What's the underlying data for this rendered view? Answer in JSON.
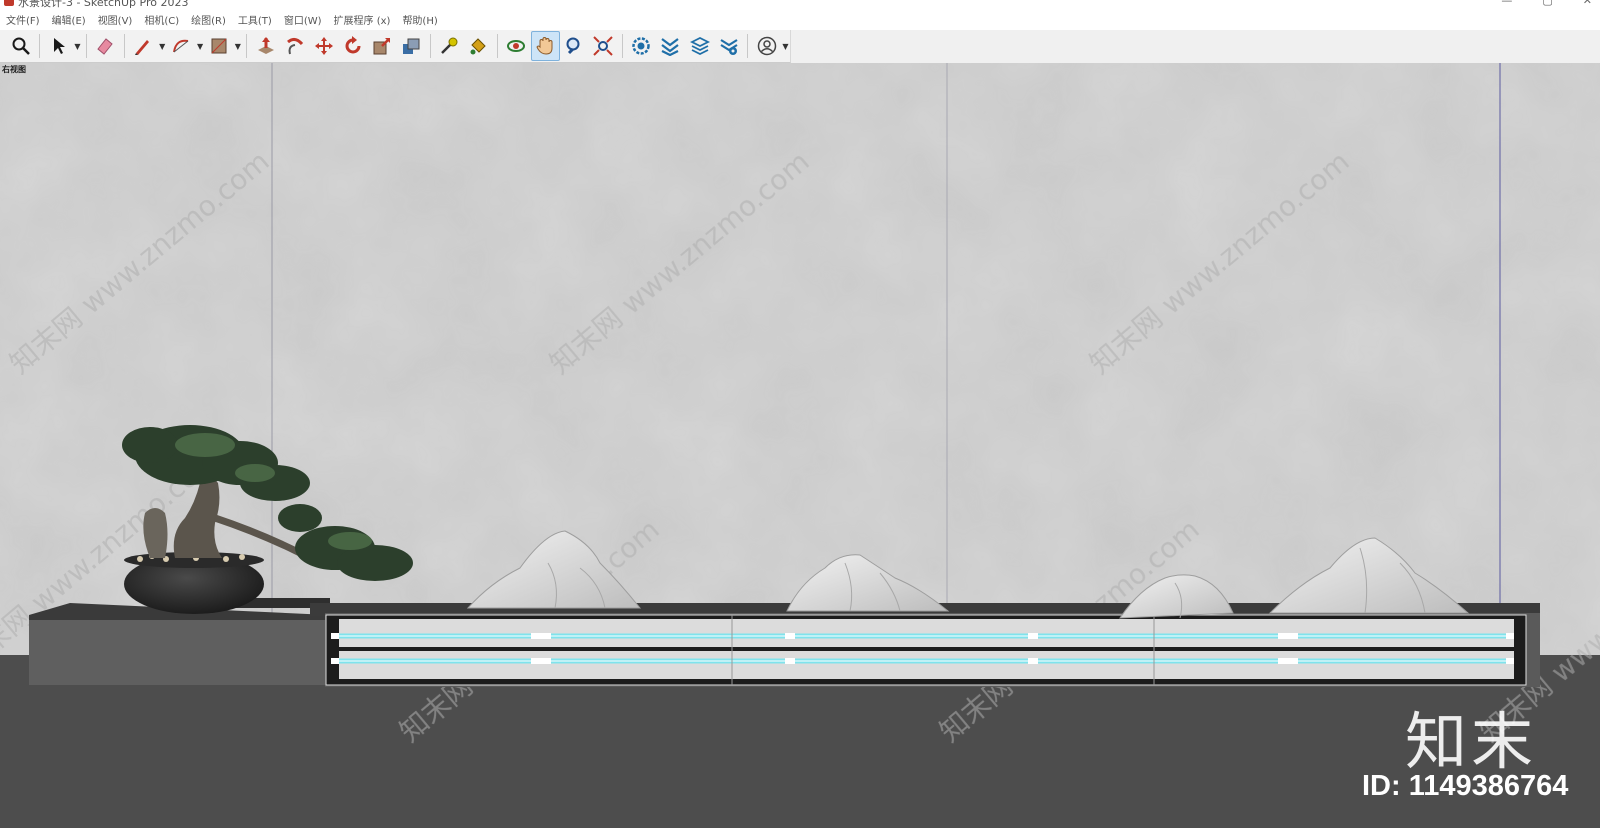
{
  "window": {
    "title": "水景设计-3 - SketchUp Pro 2023",
    "controls": [
      "—",
      "▢",
      "✕"
    ]
  },
  "menu": [
    "文件(F)",
    "编辑(E)",
    "视图(V)",
    "相机(C)",
    "绘图(R)",
    "工具(T)",
    "窗口(W)",
    "扩展程序 (x)",
    "帮助(H)"
  ],
  "toolbar": {
    "tools": [
      {
        "icon": "zoom-icon",
        "color": "#1a1a1a"
      },
      {
        "icon": "select-arrow-icon",
        "color": "#1a1a1a"
      },
      {
        "icon": "eraser-icon",
        "color": "#e78aa0"
      },
      {
        "icon": "pencil-icon",
        "color": "#c0392b"
      },
      {
        "icon": "arc-icon",
        "color": "#c0392b"
      },
      {
        "icon": "rectangle-icon",
        "color": "#8b6a4f"
      },
      {
        "icon": "push-pull-icon",
        "color": "#c0392b"
      },
      {
        "icon": "follow-me-icon",
        "color": "#c0392b"
      },
      {
        "icon": "move-icon",
        "color": "#c0392b"
      },
      {
        "icon": "rotate-icon",
        "color": "#c0392b"
      },
      {
        "icon": "scale-icon",
        "color": "#c0392b"
      },
      {
        "icon": "offset-icon",
        "color": "#555555"
      },
      {
        "icon": "tape-measure-icon",
        "color": "#b8a000"
      },
      {
        "icon": "paint-bucket-icon",
        "color": "#d4a017"
      },
      {
        "icon": "orbit-icon",
        "color": "#c0392b"
      },
      {
        "icon": "pan-hand-icon",
        "color": "#c28a4f"
      },
      {
        "icon": "zoom-tool-icon",
        "color": "#1f4e8c"
      },
      {
        "icon": "zoom-extents-icon",
        "color": "#c0392b"
      },
      {
        "icon": "3d-warehouse-icon",
        "color": "#1f6fa8"
      },
      {
        "icon": "extension-warehouse-icon",
        "color": "#1f6fa8"
      },
      {
        "icon": "layout-icon",
        "color": "#1f6fa8"
      },
      {
        "icon": "extension-manager-icon",
        "color": "#1f6fa8"
      },
      {
        "icon": "user-account-icon",
        "color": "#444444"
      }
    ]
  },
  "viewport": {
    "scene_label": "右视图",
    "watermark_text": "知末网 www.znzmo.com",
    "brand": "知末",
    "id_text": "ID: 1149386764",
    "colors": {
      "wall": "#c4c4c4",
      "floor": "#4d4d4d",
      "plinth": "#5a5a5a",
      "water_glow": "#7fe3ec",
      "rock": "#e6e6e6"
    }
  }
}
